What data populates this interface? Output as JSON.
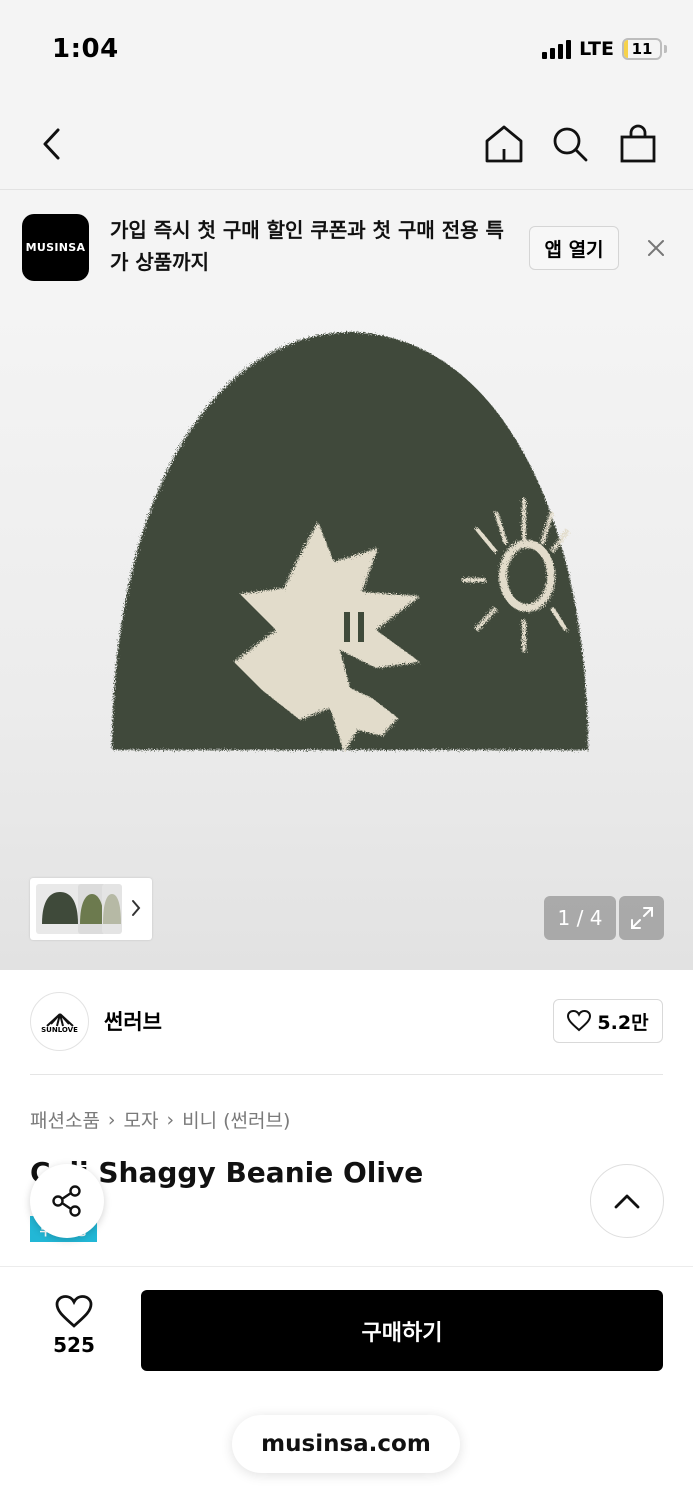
{
  "status_bar": {
    "time": "1:04",
    "network": "LTE",
    "battery": "11",
    "battery_level": 0.11,
    "battery_color": "#f6d24a"
  },
  "nav": {
    "back_icon": "chevron-left-icon",
    "home_icon": "home-icon",
    "search_icon": "search-icon",
    "cart_icon": "shopping-bag-icon"
  },
  "promo": {
    "logo_text": "MUSINSA",
    "message": "가입 즉시 첫 구매 할인 쿠폰과 첫 구매 전용 특가 상품까지",
    "open_label": "앱 열기",
    "close_icon": "close-icon"
  },
  "gallery": {
    "counter": "1 / 4",
    "expand_icon": "expand-icon",
    "thumbnail_arrow_icon": "chevron-right-icon",
    "product_color": "#3f4a3a",
    "pattern_color": "#e2dccb"
  },
  "brand": {
    "logo_text": "SUNLOVE",
    "name": "썬러브",
    "like_count": "5.2만",
    "like_icon": "heart-outline-icon"
  },
  "product": {
    "breadcrumb": [
      "패션소품",
      "모자",
      "비니 (썬러브)"
    ],
    "title": "Cali Shaggy Beanie Olive",
    "tag": "무료배송",
    "share_icon": "share-icon",
    "scroll_top_icon": "chevron-up-icon"
  },
  "bottom": {
    "wish_count": "525",
    "buy_label": "구매하기",
    "url": "musinsa.com",
    "accent": "#22b7d6"
  }
}
